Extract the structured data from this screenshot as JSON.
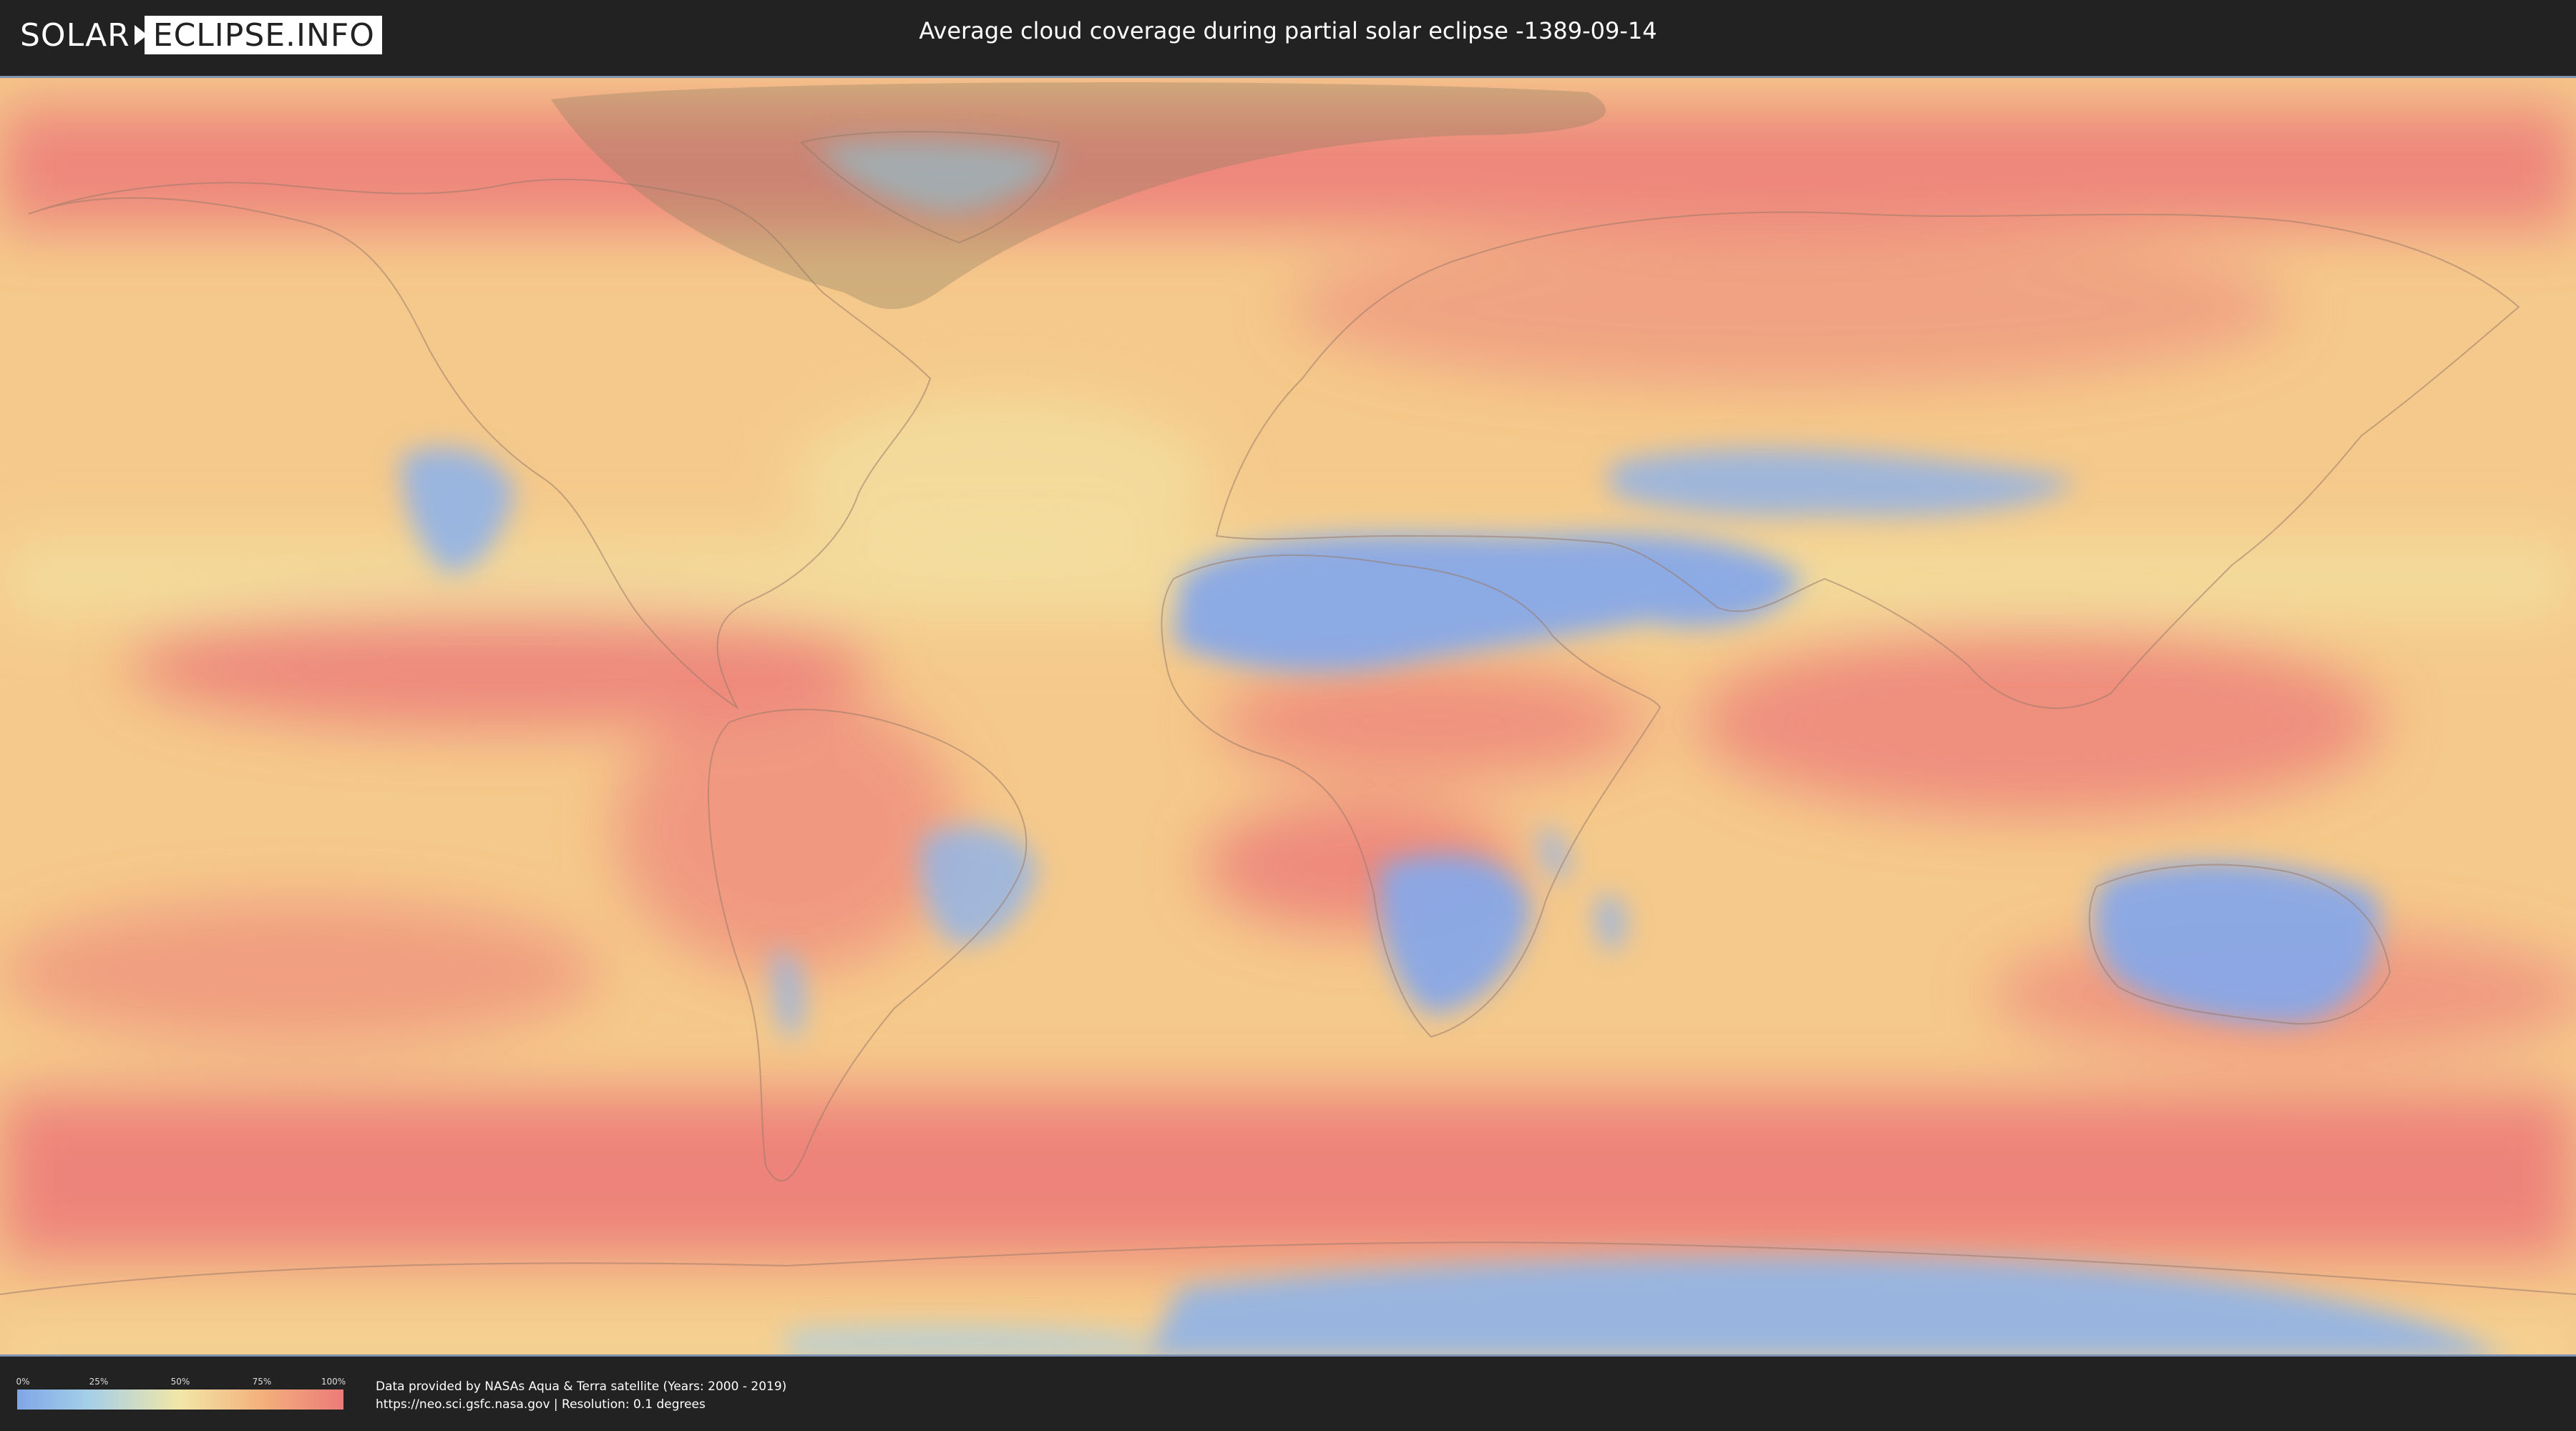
{
  "header": {
    "logo_left": "SOLAR",
    "logo_right": "ECLIPSE.INFO",
    "title": "Average cloud coverage during partial solar eclipse -1389-09-14"
  },
  "map": {
    "name": "world cloud coverage map",
    "eclipse_shadow_region": "north atlantic / greenland",
    "colors": {
      "low": "#7fa6e6",
      "mid_low": "#a6cfe8",
      "mid": "#f2e6a6",
      "mid_high": "#f3b07c",
      "high": "#ec7b79"
    }
  },
  "legend": {
    "ticks": [
      "0%",
      "25%",
      "50%",
      "75%",
      "100%"
    ]
  },
  "footer": {
    "line1": "Data provided by NASAs Aqua & Terra satellite (Years: 2000 - 2019)",
    "line2": "https://neo.sci.gsfc.nasa.gov | Resolution: 0.1 degrees"
  }
}
